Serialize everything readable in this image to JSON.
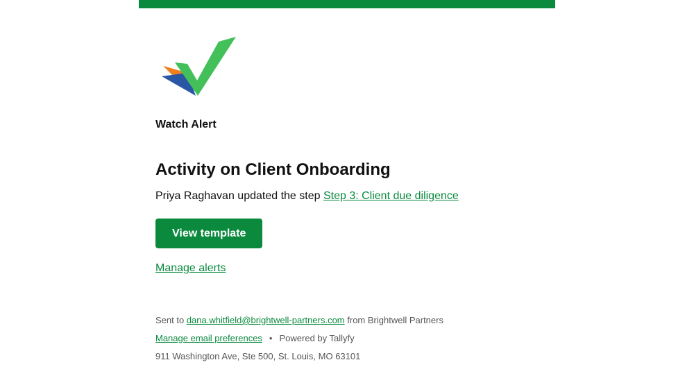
{
  "brand": {
    "accent_color": "#0b8a3e",
    "logo_icon": "checkmark-logo-icon"
  },
  "alert": {
    "label": "Watch Alert",
    "headline": "Activity on Client Onboarding",
    "actor": "Priya Raghavan",
    "action_text": "updated the step",
    "step_link": "Step 3: Client due diligence",
    "cta_label": "View template",
    "manage_alerts_label": "Manage alerts"
  },
  "footer": {
    "sent_to_prefix": "Sent to",
    "recipient_email": "dana.whitfield@brightwell-partners.com",
    "from_text": "from Brightwell Partners",
    "preferences_link": "Manage email preferences",
    "separator": "•",
    "powered_by": "Powered by Tallyfy",
    "address": "911 Washington Ave, Ste 500, St. Louis, MO 63101"
  }
}
